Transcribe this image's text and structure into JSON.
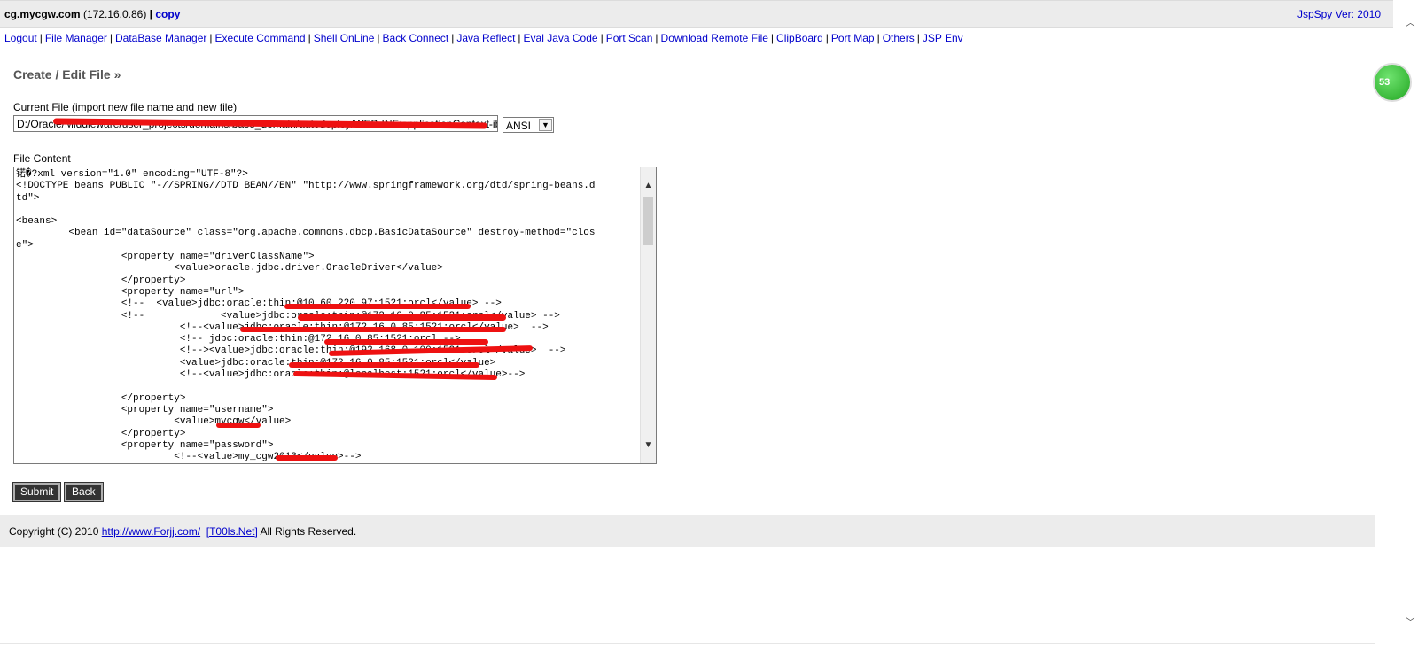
{
  "header": {
    "hostname": "cg.mycgw.com",
    "ip": "(172.16.0.86)",
    "separator": "|",
    "copy_label": "copy",
    "version": "JspSpy Ver: 2010"
  },
  "nav": {
    "items": [
      {
        "label": "Logout"
      },
      {
        "label": "File Manager"
      },
      {
        "label": "DataBase Manager"
      },
      {
        "label": "Execute Command"
      },
      {
        "label": "Shell OnLine"
      },
      {
        "label": "Back Connect"
      },
      {
        "label": "Java Reflect"
      },
      {
        "label": "Eval Java Code"
      },
      {
        "label": "Port Scan"
      },
      {
        "label": "Download Remote File"
      },
      {
        "label": "ClipBoard"
      },
      {
        "label": "Port Map"
      },
      {
        "label": "Others"
      },
      {
        "label": "JSP Env"
      }
    ],
    "separator": "|"
  },
  "main": {
    "heading": "Create / Edit File »",
    "current_file_label": "Current File (import new file name and new file)",
    "current_file_value": "D:/Oracle/Middleware/user_projects/domains/base_domain/autodeploy/WEB-INF/applicationContext-ibatis.xml",
    "charset": "ANSI",
    "file_content_label": "File Content",
    "file_content": "锘�?xml version=\"1.0\" encoding=\"UTF-8\"?>\n<!DOCTYPE beans PUBLIC \"-//SPRING//DTD BEAN//EN\" \"http://www.springframework.org/dtd/spring-beans.d\ntd\">\n\n<beans>\n         <bean id=\"dataSource\" class=\"org.apache.commons.dbcp.BasicDataSource\" destroy-method=\"clos\ne\">\n                  <property name=\"driverClassName\">\n                           <value>oracle.jdbc.driver.OracleDriver</value>\n                  </property>\n                  <property name=\"url\">\n                  <!--  <value>jdbc:oracle:thin:@10.60.220.97:1521:orcl</value> -->\n                  <!--             <value>jdbc:oracle:thin:@172.16.0.85:1521:orcl</value> -->\n                            <!--<value>jdbc:oracle:thin:@172.16.0.85:1521:orcl</value>  -->\n                            <!-- jdbc:oracle:thin:@172.16.0.85:1521:orcl -->\n                            <!--><value>jdbc:oracle:thin:@192.168.0.100:1521:orcl</value>  -->\n                            <value>jdbc:oracle:thin:@172.16.0.85:1521:orcl</value>\n                            <!--<value>jdbc:oracle:thin:@localhost:1521:orcl</value>-->\n\n                  </property>\n                  <property name=\"username\">\n                           <value>mycgw</value>\n                  </property>\n                  <property name=\"password\">\n                           <!--<value>my_cgw2013</value>-->",
    "submit_label": "Submit",
    "back_label": "Back"
  },
  "footer": {
    "copyright": "Copyright (C) 2010",
    "site_link": "http://www.Forjj.com/",
    "tools_link": "[T00ls.Net]",
    "rights": "All Rights Reserved."
  },
  "badge": {
    "value": "53"
  }
}
